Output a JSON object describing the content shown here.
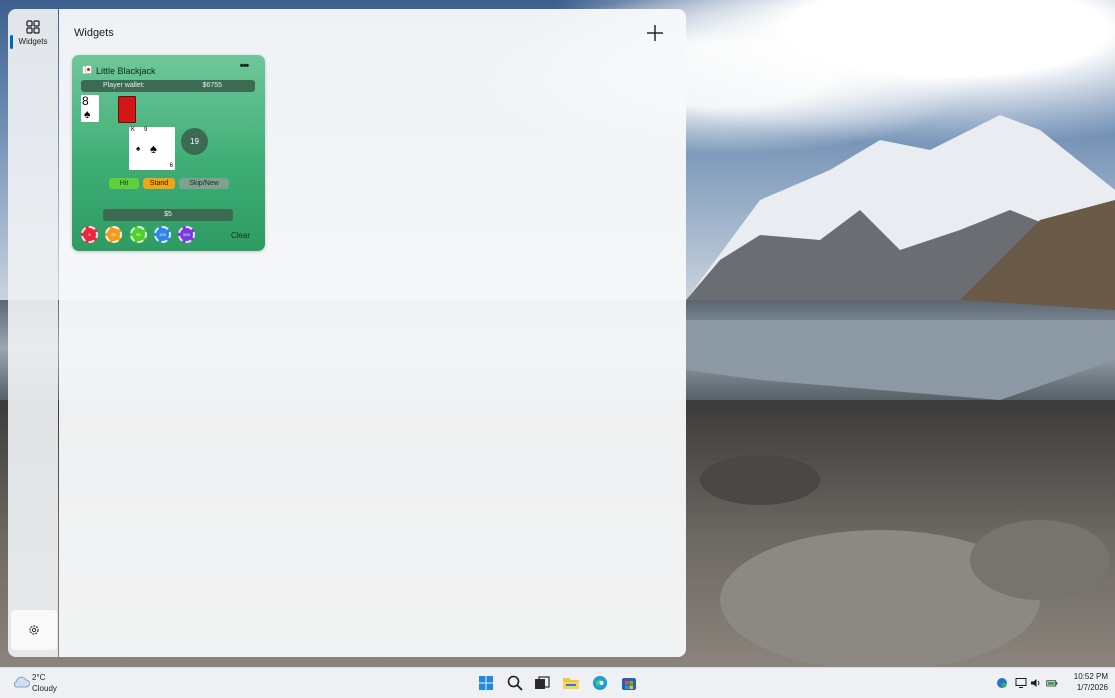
{
  "nav": {
    "widgets_label": "Widgets"
  },
  "board": {
    "title": "Widgets"
  },
  "blackjack": {
    "title": "Little Blackjack",
    "more_label": "•••",
    "wallet_label": "Player wallet:",
    "wallet_value": "$6755",
    "dealer_card": {
      "rank": "8",
      "suit": "♠"
    },
    "player_cards": {
      "rank_1": "K",
      "rank_2": "9",
      "rank_3": "6",
      "suit_small": "♠",
      "suit_big": "♠"
    },
    "score": "19",
    "actions": {
      "hit": "Hit",
      "stand": "Stand",
      "skip": "Skip/New"
    },
    "bet_value": "$5",
    "chips": [
      "5",
      "25",
      "50",
      "100",
      "500"
    ],
    "clear_label": "Clear",
    "colors": {
      "table_green": "#3fae76",
      "hit": "#5fd03a",
      "stand": "#f2a318"
    }
  },
  "taskbar": {
    "weather_temp": "2°C",
    "weather_condition": "Cloudy",
    "time": "10:52 PM",
    "date": "1/7/2026"
  },
  "icons": {
    "start": "windows-logo-icon",
    "search": "search-icon",
    "task_view": "task-view-icon",
    "file_explorer": "folder-icon",
    "edge": "edge-browser-icon",
    "store": "store-icon"
  }
}
